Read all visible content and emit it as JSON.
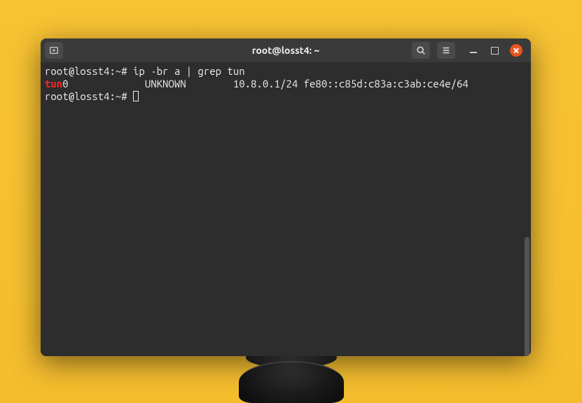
{
  "window": {
    "title": "root@losst4: ~"
  },
  "terminal": {
    "prompt": "root@losst4:~#",
    "command1": "ip -br a | grep tun",
    "output": {
      "match": "tun",
      "rest_iface": "0             ",
      "state": "UNKNOWN        ",
      "addrs": "10.8.0.1/24 fe80::c85d:c83a:c3ab:ce4e/64 "
    }
  }
}
